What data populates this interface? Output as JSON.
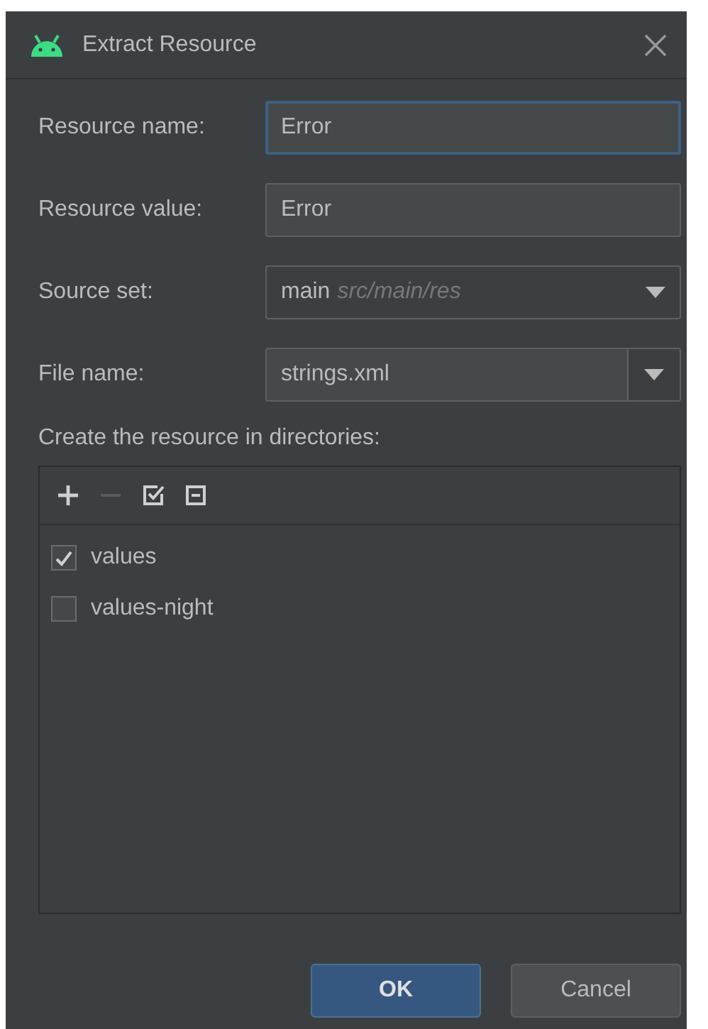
{
  "window": {
    "title": "Extract Resource"
  },
  "fields": [
    {
      "label": "Resource name:",
      "kind": "text",
      "value": "Error",
      "focused": true
    },
    {
      "label": "Resource value:",
      "kind": "text",
      "value": "Error",
      "focused": false
    },
    {
      "label": "Source set:",
      "kind": "combo",
      "value": "main",
      "hint": "src/main/res"
    },
    {
      "label": "File name:",
      "kind": "editable-combo",
      "value": "strings.xml"
    }
  ],
  "directories": {
    "label": "Create the resource in directories:",
    "toolbar": [
      {
        "kind": "add",
        "disabled": false
      },
      {
        "kind": "remove",
        "disabled": true
      },
      {
        "kind": "select-all",
        "disabled": false
      },
      {
        "kind": "unselect-all",
        "disabled": false
      }
    ],
    "items": [
      {
        "label": "values",
        "checked": true
      },
      {
        "label": "values-night",
        "checked": false
      }
    ]
  },
  "buttons": [
    {
      "label": "OK",
      "default": true
    },
    {
      "label": "Cancel",
      "default": false
    }
  ]
}
